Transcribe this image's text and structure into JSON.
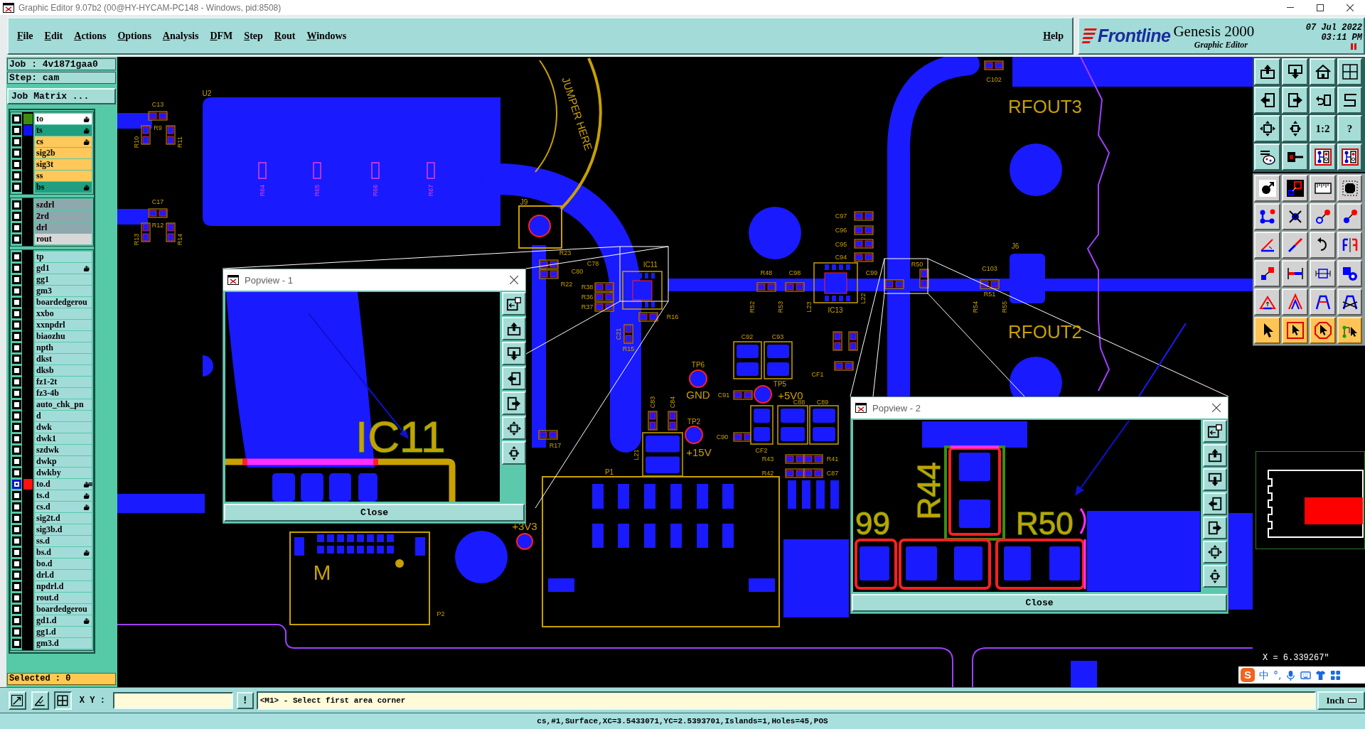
{
  "window": {
    "title": "Graphic Editor 9.07b2 (00@HY-HYCAM-PC148 - Windows, pid:8508)"
  },
  "menu": {
    "items": [
      "File",
      "Edit",
      "Actions",
      "Options",
      "Analysis",
      "DFM",
      "Step",
      "Rout",
      "Windows"
    ],
    "help": "Help"
  },
  "brand": {
    "logo": "Frontline",
    "product": "Genesis 2000",
    "subtitle": "Graphic Editor",
    "date": "07 Jul 2022",
    "time": "03:11 PM"
  },
  "job_panel": {
    "job": "Job : 4v1871gaa0",
    "step": "Step: cam",
    "matrix_button": "Job Matrix ...",
    "layer_groups": [
      {
        "layers": [
          {
            "name": "to",
            "kind": "silk_screen",
            "color": "#3c8c14",
            "affected": true,
            "selected": false
          },
          {
            "name": "ts",
            "kind": "solder_mask",
            "color": "#1010f0",
            "affected": true,
            "selected": false
          },
          {
            "name": "cs",
            "kind": "signal",
            "affected": true,
            "selected": false
          },
          {
            "name": "sig2b",
            "kind": "signal",
            "affected": false,
            "selected": false
          },
          {
            "name": "sig3t",
            "kind": "signal",
            "affected": false,
            "selected": false
          },
          {
            "name": "ss",
            "kind": "signal",
            "affected": false,
            "selected": false
          },
          {
            "name": "bs",
            "kind": "solder_mask",
            "affected": true,
            "selected": false
          }
        ]
      },
      {
        "layers": [
          {
            "name": "szdrl",
            "kind": "drill",
            "affected": false,
            "selected": false
          },
          {
            "name": "2rd",
            "kind": "drill",
            "affected": false,
            "selected": false
          },
          {
            "name": "drl",
            "kind": "drill",
            "affected": false,
            "selected": false
          },
          {
            "name": "rout",
            "kind": "rout",
            "affected": false,
            "selected": false
          }
        ]
      },
      {
        "layers": [
          {
            "name": "tp",
            "kind": "document",
            "affected": false,
            "selected": false
          },
          {
            "name": "gd1",
            "kind": "document",
            "affected": true,
            "selected": false
          },
          {
            "name": "gg1",
            "kind": "document",
            "affected": false,
            "selected": false
          },
          {
            "name": "gm3",
            "kind": "document",
            "affected": false,
            "selected": false
          },
          {
            "name": "boardedgerou",
            "kind": "document",
            "affected": false,
            "selected": false
          },
          {
            "name": "xxbo",
            "kind": "document",
            "affected": false,
            "selected": false
          },
          {
            "name": "xxnpdrl",
            "kind": "document",
            "affected": false,
            "selected": false
          },
          {
            "name": "biaozhu",
            "kind": "document",
            "affected": false,
            "selected": false
          },
          {
            "name": "npth",
            "kind": "document",
            "affected": false,
            "selected": false
          },
          {
            "name": "dkst",
            "kind": "document",
            "affected": false,
            "selected": false
          },
          {
            "name": "dksb",
            "kind": "document",
            "affected": false,
            "selected": false
          },
          {
            "name": "fz1-2t",
            "kind": "document",
            "affected": false,
            "selected": false
          },
          {
            "name": "fz3-4b",
            "kind": "document",
            "affected": false,
            "selected": false
          },
          {
            "name": "auto_chk_pn",
            "kind": "document",
            "affected": false,
            "selected": false
          },
          {
            "name": "d",
            "kind": "document",
            "affected": false,
            "selected": false
          },
          {
            "name": "dwk",
            "kind": "document",
            "affected": false,
            "selected": false
          },
          {
            "name": "dwk1",
            "kind": "document",
            "affected": false,
            "selected": false
          },
          {
            "name": "szdwk",
            "kind": "document",
            "affected": false,
            "selected": false
          },
          {
            "name": "dwkp",
            "kind": "document",
            "affected": false,
            "selected": false
          },
          {
            "name": "dwkby",
            "kind": "document",
            "affected": false,
            "selected": false
          },
          {
            "name": "to.d",
            "kind": "document",
            "color": "#ff1010",
            "affected": true,
            "selected": true
          },
          {
            "name": "ts.d",
            "kind": "document",
            "affected": true,
            "selected": false
          },
          {
            "name": "cs.d",
            "kind": "document",
            "affected": true,
            "selected": false
          },
          {
            "name": "sig2t.d",
            "kind": "document",
            "affected": false,
            "selected": false
          },
          {
            "name": "sig3b.d",
            "kind": "document",
            "affected": false,
            "selected": false
          },
          {
            "name": "ss.d",
            "kind": "document",
            "affected": false,
            "selected": false
          },
          {
            "name": "bs.d",
            "kind": "document",
            "affected": true,
            "selected": false
          },
          {
            "name": "bo.d",
            "kind": "document",
            "affected": false,
            "selected": false
          },
          {
            "name": "drl.d",
            "kind": "document",
            "affected": false,
            "selected": false
          },
          {
            "name": "npdrl.d",
            "kind": "document",
            "affected": false,
            "selected": false
          },
          {
            "name": "rout.d",
            "kind": "document",
            "affected": false,
            "selected": false
          },
          {
            "name": "boardedgerou",
            "kind": "document",
            "affected": false,
            "selected": false
          },
          {
            "name": "gd1.d",
            "kind": "document",
            "affected": true,
            "selected": false
          },
          {
            "name": "gg1.d",
            "kind": "document",
            "affected": false,
            "selected": false
          },
          {
            "name": "gm3.d",
            "kind": "document",
            "affected": false,
            "selected": false
          }
        ]
      }
    ],
    "selected_count": "Selected : 0"
  },
  "canvas": {
    "labels": [
      "U2",
      "C13",
      "R9",
      "R10",
      "R11",
      "C17",
      "R12",
      "R13",
      "R14",
      "J9",
      "JUMPER HERE",
      "C78",
      "IC11",
      "C80",
      "R23",
      "R22",
      "R38",
      "R36",
      "R37",
      "R16",
      "C21",
      "R15",
      "C97",
      "C96",
      "C95",
      "C94",
      "R48",
      "C98",
      "R52",
      "R53",
      "L23",
      "IC13",
      "L22",
      "C99",
      "R50",
      "C102",
      "RFOUT3",
      "J6",
      "C103",
      "R54",
      "R51",
      "R55",
      "RFOUT2",
      "TP6",
      "GND",
      "C92",
      "C93",
      "C91",
      "TP5",
      "+5V0",
      "CF1",
      "C83",
      "C84",
      "TP2",
      "+15V",
      "C90",
      "L21",
      "CF2",
      "R43",
      "R42",
      "R41",
      "C87",
      "C88",
      "C89",
      "R17",
      "P1",
      "+3V3",
      "M",
      "P2"
    ],
    "resistor_marks": [
      "R64",
      "R65",
      "R66",
      "R67"
    ]
  },
  "popviews": [
    {
      "title": "Popview - 1",
      "labels": [
        "IC11"
      ],
      "close_button": "Close"
    },
    {
      "title": "Popview - 2",
      "labels": [
        "99",
        "R44",
        "R50"
      ],
      "close_button": "Close"
    }
  ],
  "toolbar": {
    "groups": [
      {
        "buttons": [
          {
            "kind": "view"
          },
          {
            "kind": "view"
          },
          {
            "kind": "view"
          },
          {
            "kind": "view"
          },
          {
            "kind": "view"
          },
          {
            "kind": "view"
          },
          {
            "kind": "view"
          },
          {
            "kind": "view"
          },
          {
            "kind": "view"
          },
          {
            "kind": "view"
          },
          {
            "kind": "view",
            "label": "1:2"
          },
          {
            "kind": "view",
            "label": "?"
          },
          {
            "kind": "view"
          },
          {
            "kind": "view"
          },
          {
            "kind": "view"
          },
          {
            "kind": "view"
          }
        ]
      },
      {
        "buttons": [
          {
            "kind": "tool"
          },
          {
            "kind": "tool"
          },
          {
            "kind": "tool"
          },
          {
            "kind": "tool"
          },
          {
            "kind": "tool"
          },
          {
            "kind": "tool"
          },
          {
            "kind": "tool"
          },
          {
            "kind": "tool"
          },
          {
            "kind": "tool"
          },
          {
            "kind": "tool"
          },
          {
            "kind": "tool"
          },
          {
            "kind": "tool"
          },
          {
            "kind": "tool"
          },
          {
            "kind": "tool"
          },
          {
            "kind": "tool"
          },
          {
            "kind": "tool"
          },
          {
            "kind": "tool"
          },
          {
            "kind": "tool"
          },
          {
            "kind": "tool"
          },
          {
            "kind": "tool"
          },
          {
            "kind": "select"
          },
          {
            "kind": "select"
          },
          {
            "kind": "select"
          },
          {
            "kind": "select"
          }
        ]
      }
    ]
  },
  "readout": "X = 6.339267\"",
  "ime": {
    "logo": "S",
    "mode": "中",
    "punctuation": "°,"
  },
  "command_bar": {
    "xy_label": "X Y :",
    "alert_button": "!",
    "message": "<M1> - Select first area corner",
    "units": "Inch"
  },
  "status_bar": "cs,#1,Surface,XC=3.5433071,YC=2.5393701,Islands=1,Holes=45,POS"
}
